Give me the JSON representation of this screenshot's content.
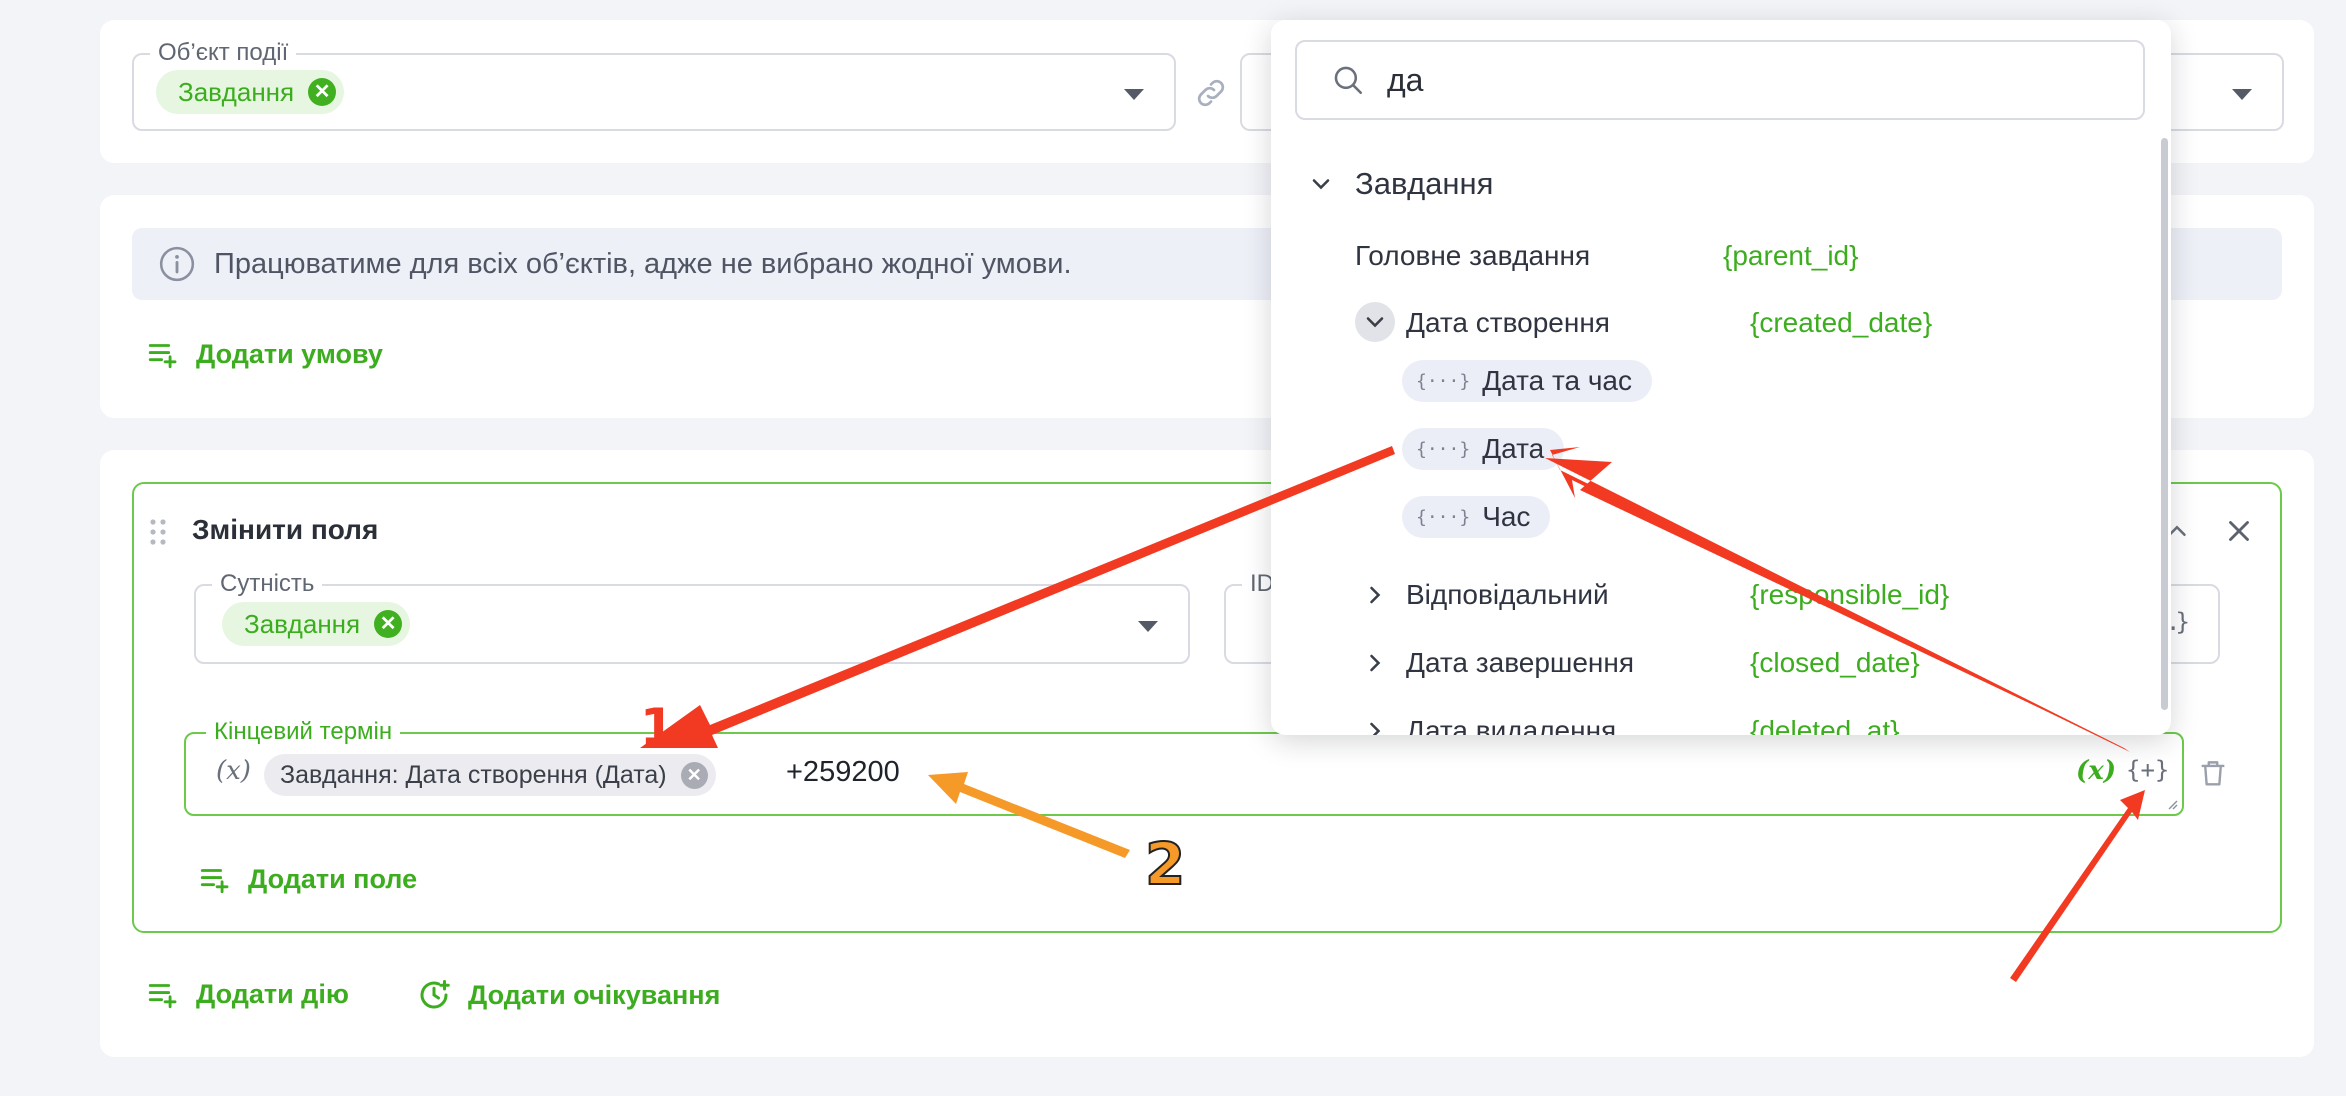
{
  "event_object": {
    "legend": "Об’єкт події",
    "chip": "Завдання"
  },
  "info": {
    "text": "Працюватиме для всіх об’єктів, адже не вибрано жодної умови.",
    "add_condition": "Додати умову"
  },
  "action": {
    "title": "Змінити поля",
    "entity_legend": "Сутність",
    "entity_chip": "Завдання",
    "id_legend": "ID",
    "deadline_legend": "Кінцевий термін",
    "fx_label": "(x)",
    "field_chip": "Завдання: Дата створення (Дата)",
    "expression": "+259200",
    "add_field": "Додати поле",
    "braces_partial": "…}"
  },
  "footer": {
    "add_action": "Додати дію",
    "add_wait": "Додати очікування"
  },
  "dropdown": {
    "search_value": "да",
    "group": "Завдання",
    "items": [
      {
        "label": "Головне завдання",
        "tag": "{parent_id}"
      },
      {
        "label": "Дата створення",
        "tag": "{created_date}"
      },
      {
        "label": "Відповідальний",
        "tag": "{responsible_id}"
      },
      {
        "label": "Дата завершення",
        "tag": "{closed_date}"
      },
      {
        "label": "Дата видалення",
        "tag": "{deleted_at}"
      }
    ],
    "sub_items": [
      "Дата та час",
      "Дата",
      "Час"
    ]
  },
  "annotations": {
    "marker_1": "1",
    "marker_2": "2",
    "arrow_color": "#f23a22",
    "arrow2_color": "#f59a28"
  },
  "colors": {
    "accent_green": "#3cad1e",
    "background": "#f3f4f8"
  }
}
